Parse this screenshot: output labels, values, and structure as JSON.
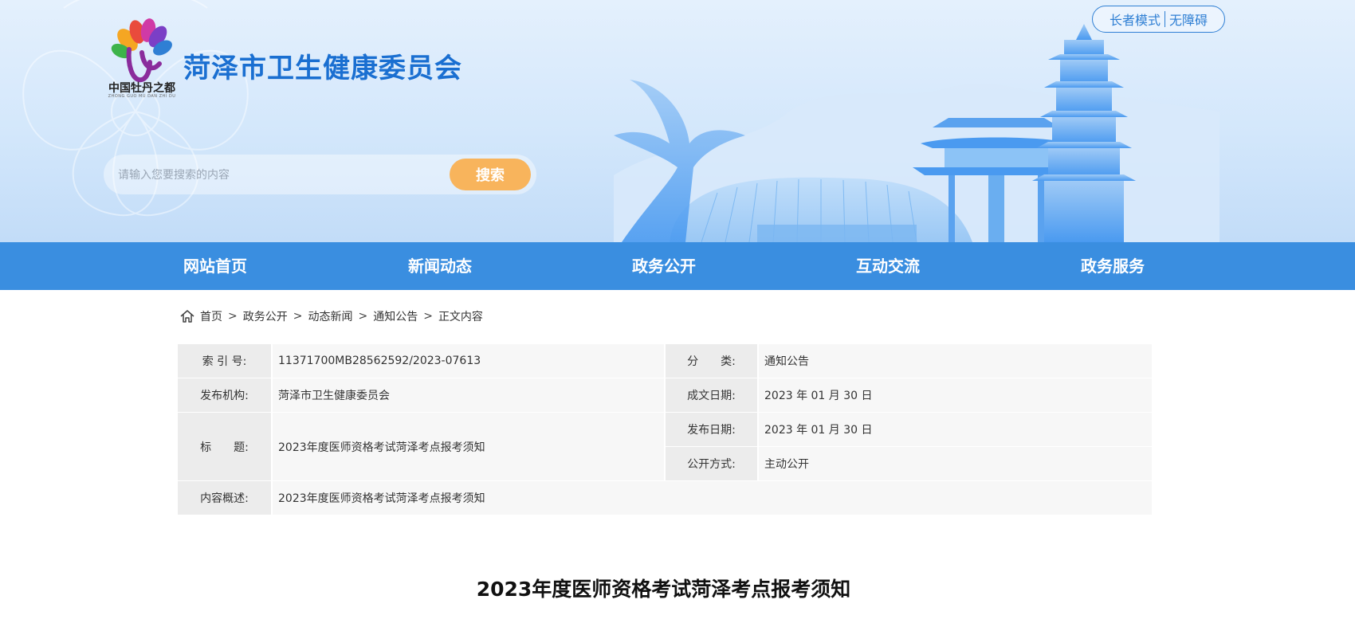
{
  "header": {
    "site_title": "菏泽市卫生健康委员会",
    "logo_text": "中国牡丹之都",
    "logo_sub": "ZHONG GUO MU DAN ZHI DU",
    "senior_mode": "长者模式",
    "accessibility": "无障碍",
    "search": {
      "placeholder": "请输入您要搜索的内容",
      "button": "搜索"
    }
  },
  "nav": {
    "items": [
      "网站首页",
      "新闻动态",
      "政务公开",
      "互动交流",
      "政务服务"
    ]
  },
  "breadcrumb": [
    "首页",
    "政务公开",
    "动态新闻",
    "通知公告",
    "正文内容"
  ],
  "breadcrumb_sep": ">",
  "meta": {
    "index_label": "索 引 号:",
    "index_value": "11371700MB28562592/2023-07613",
    "category_label": "分　　类:",
    "category_value": "通知公告",
    "publisher_label": "发布机构:",
    "publisher_value": "菏泽市卫生健康委员会",
    "created_label": "成文日期:",
    "created_value": "2023 年 01 月 30 日",
    "title_label": "标　　题:",
    "title_value": "2023年度医师资格考试菏泽考点报考须知",
    "published_label": "发布日期:",
    "published_value": "2023 年 01 月 30 日",
    "disclosure_label": "公开方式:",
    "disclosure_value": "主动公开",
    "summary_label": "内容概述:",
    "summary_value": "2023年度医师资格考试菏泽考点报考须知"
  },
  "article": {
    "title": "2023年度医师资格考试菏泽考点报考须知"
  },
  "colors": {
    "nav": "#3a8ee0",
    "title": "#1a6fd1",
    "search_button": "#f8b45c"
  }
}
